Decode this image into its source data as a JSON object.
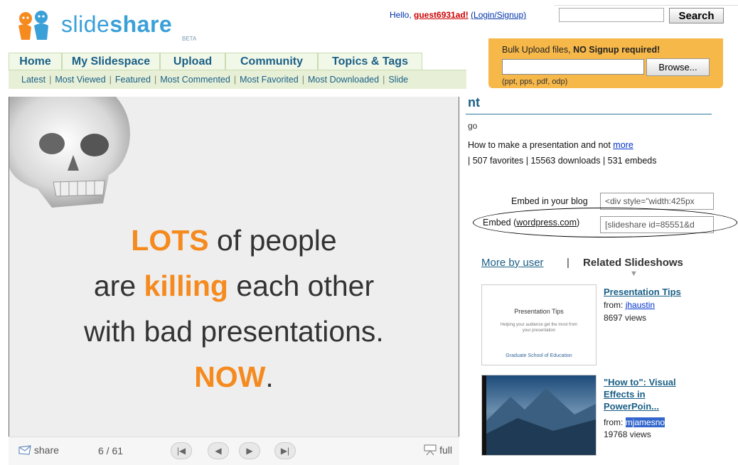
{
  "logo": {
    "word_light": "slide",
    "word_bold": "share",
    "badge": "BETA"
  },
  "header": {
    "greeting_prefix": "Hello, ",
    "username": "guest6931ad!",
    "login_text": "(Login/Signup)",
    "search_value": "",
    "search_button": "Search"
  },
  "nav": {
    "tabs": [
      "Home",
      "My Slidespace",
      "Upload",
      "Community",
      "Topics & Tags"
    ],
    "sublinks": [
      "Latest",
      "Most Viewed",
      "Featured",
      "Most Commented",
      "Most Favorited",
      "Most Downloaded",
      "Slide"
    ]
  },
  "upload": {
    "prefix": "Bulk Upload files,",
    "emphasis": "NO Signup required!",
    "browse_button": "Browse...",
    "hint": "(ppt, pps, pdf, odp)"
  },
  "slide": {
    "line1_em": "LOTS",
    "line1_rest": " of people",
    "line2_a": "are ",
    "line2_em": "killing",
    "line2_b": " each other",
    "line3": "with bad presentations.",
    "line4_em": "NOW",
    "line4_rest": "."
  },
  "player": {
    "share_label": "share",
    "page_counter": "6 / 61",
    "full_label": "full"
  },
  "details": {
    "title_fragment": "nt",
    "ago_fragment": "go",
    "description": "How to make a presentation and not ",
    "more_link": "more",
    "stats": "| 507 favorites | 15563 downloads | 531 embeds"
  },
  "embed": {
    "blog_label": "Embed in your blog",
    "blog_value": "<div style=\"width:425px",
    "wp_label_prefix": "Embed (",
    "wp_link": "wordpress.com",
    "wp_label_suffix": ")",
    "wp_value": "[slideshare id=85551&d"
  },
  "related": {
    "tab_more": "More by user",
    "tab_separator": "|",
    "tab_related": "Related Slideshows",
    "from_label": "from:",
    "items": [
      {
        "title": "Presentation Tips",
        "author": "jhaustin",
        "views": "8697 views",
        "thumb_title": "Presentation Tips",
        "thumb_subtitle": "Helping your audience get the most from your presentation",
        "thumb_footer": "Graduate School of Education"
      },
      {
        "title_line1": "\"How to\": Visual",
        "title_line2": "Effects in",
        "title_line3": "PowerPoin...",
        "author": "mjamesno",
        "views": "19768 views"
      }
    ]
  }
}
